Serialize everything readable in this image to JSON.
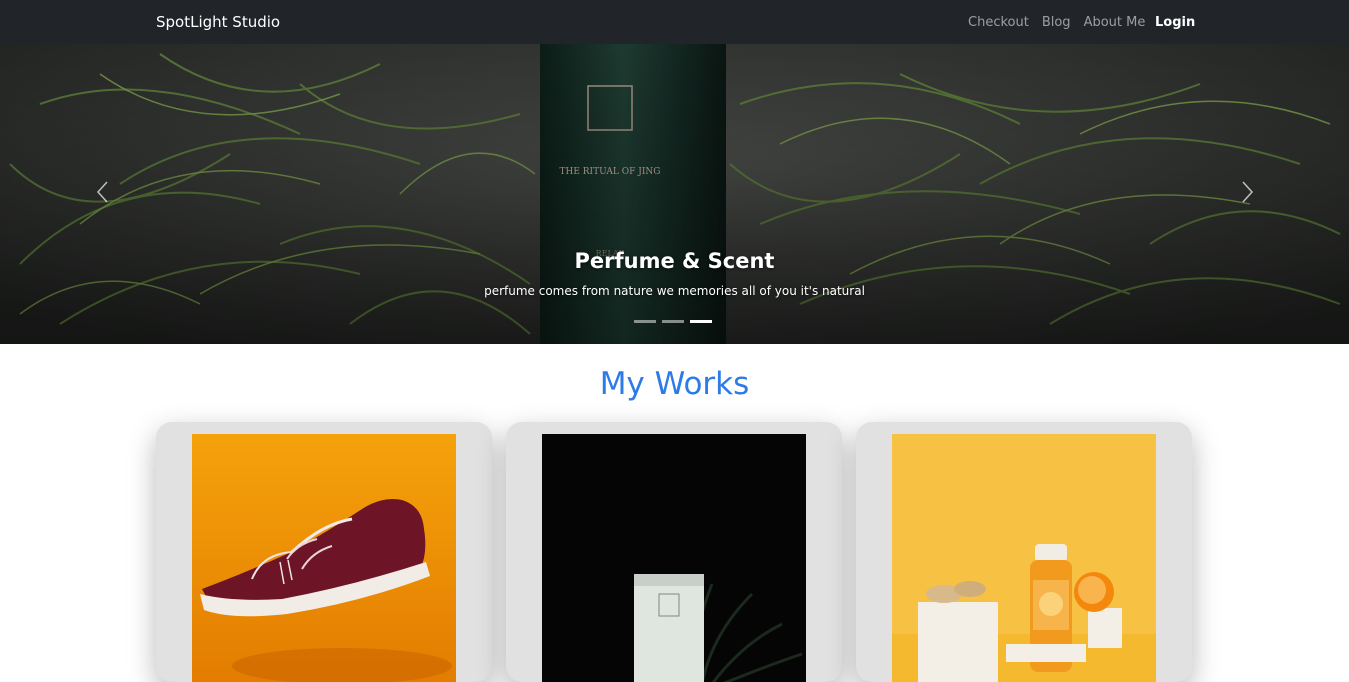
{
  "navbar": {
    "brand": "SpotLight Studio",
    "links": [
      {
        "label": "Checkout"
      },
      {
        "label": "Blog"
      },
      {
        "label": "About Me"
      }
    ],
    "login_label": "Login"
  },
  "carousel": {
    "title": "Perfume & Scent",
    "text": "perfume comes from nature we memories all of you it's natural",
    "slide_count": 3,
    "active_slide": 3,
    "bottle_text": "RIT UAL S...",
    "bottle_subtitle": "THE RITUAL OF JING"
  },
  "works": {
    "title": "My Works",
    "items": [
      {
        "name": "sneaker-photo"
      },
      {
        "name": "lotion-tube-photo"
      },
      {
        "name": "juice-bottle-photo"
      }
    ]
  },
  "colors": {
    "navbar_bg": "#212529",
    "accent": "#2d7be8",
    "card_bg": "#e1e1e1"
  }
}
